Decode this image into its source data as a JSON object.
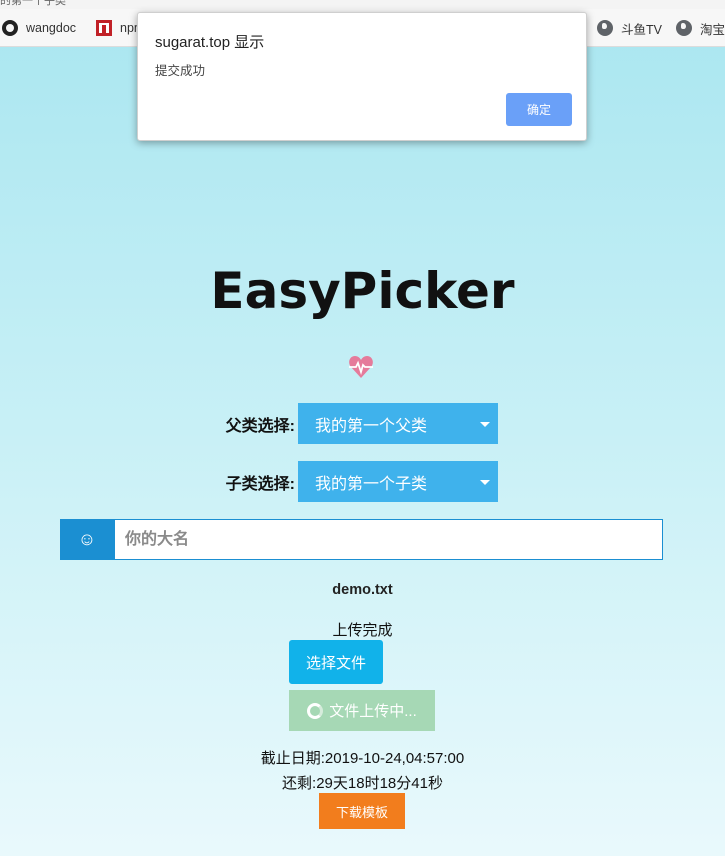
{
  "browser": {
    "tab_fragment": "的第一个子类",
    "bookmarks": [
      {
        "label": "wangdoc",
        "icon": "github-icon"
      },
      {
        "label": "npm",
        "icon": "npm-icon"
      },
      {
        "label": "斗鱼TV",
        "icon": "globe-icon"
      },
      {
        "label": "淘宝",
        "icon": "globe-icon"
      }
    ]
  },
  "dialog": {
    "title": "sugarat.top 显示",
    "message": "提交成功",
    "ok_label": "确定"
  },
  "app": {
    "title": "EasyPicker",
    "parent_label": "父类选择:",
    "parent_value": "我的第一个父类",
    "child_label": "子类选择:",
    "child_value": "我的第一个子类",
    "name_icon": "☺",
    "name_placeholder": "你的大名",
    "file_name": "demo.txt",
    "upload_status": "上传完成",
    "choose_file_label": "选择文件",
    "uploading_label": "文件上传中...",
    "deadline": "截止日期:2019-10-24,04:57:00",
    "remaining": "还剩:29天18时18分41秒",
    "download_template_label": "下载模板"
  },
  "colors": {
    "select_bg": "#3fb2ec",
    "addon_bg": "#1b8fd2",
    "choose_btn": "#11b2ea",
    "upload_btn": "#a6d8b5",
    "template_btn": "#f27d1d",
    "dialog_ok": "#6aa0f8"
  }
}
